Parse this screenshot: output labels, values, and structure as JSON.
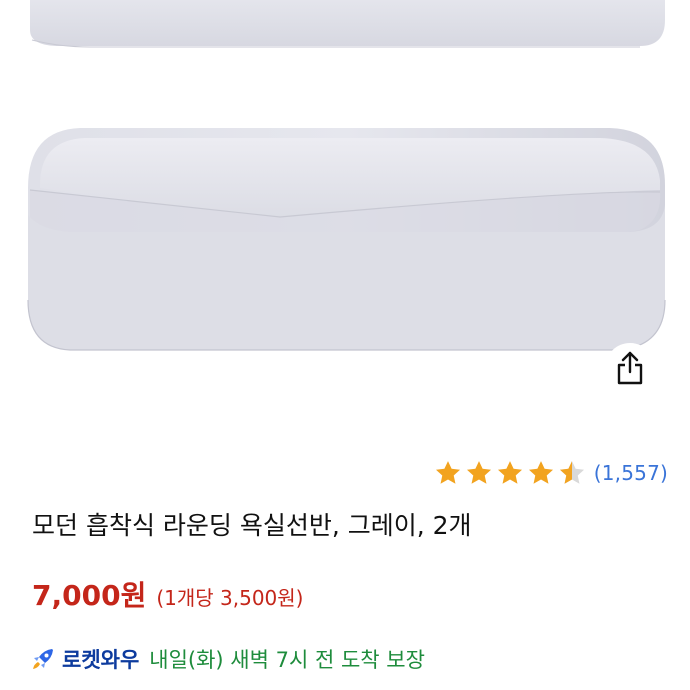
{
  "product": {
    "title": "모던 흡착식 라운딩 욕실선반, 그레이, 2개",
    "rating": 4.5,
    "review_count": "(1,557)",
    "price": "7,000원",
    "unit_price": "(1개당 3,500원)"
  },
  "delivery": {
    "badge_label": "로켓와우",
    "text": "내일(화) 새벽 7시 전 도착 보장"
  },
  "icons": {
    "share": "share-icon",
    "rocket": "rocket-icon",
    "star": "star-icon"
  },
  "colors": {
    "star": "#f2a31f",
    "star_empty": "#d9d9d9",
    "price": "#c4261a",
    "review_count": "#3a74d8",
    "rocket_badge": "#0d3b9e",
    "delivery": "#1e8c3c"
  }
}
